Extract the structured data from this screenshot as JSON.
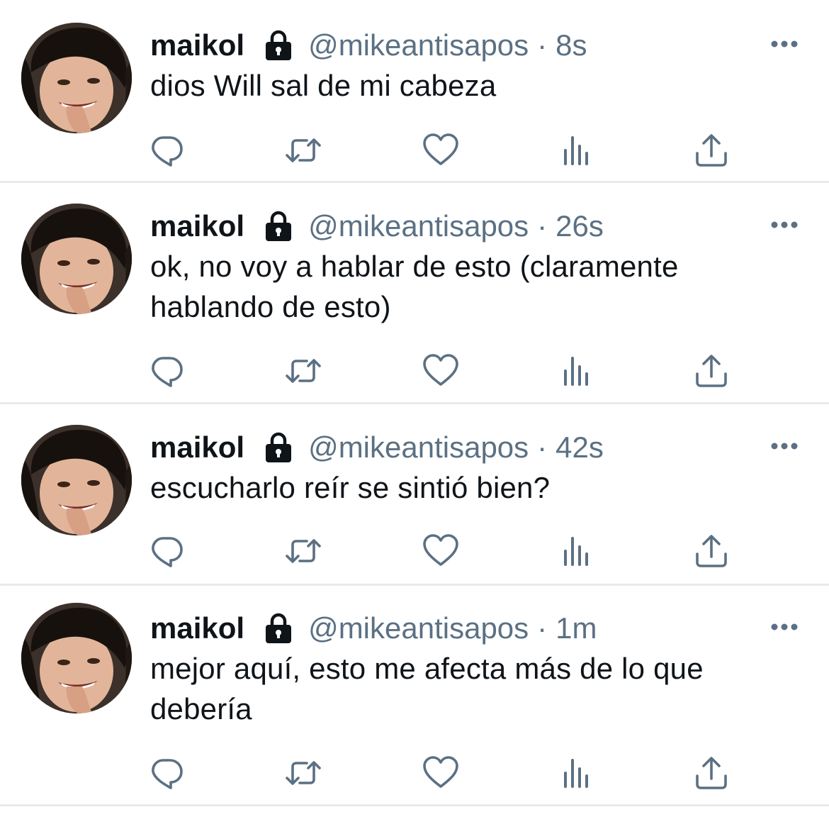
{
  "tweets": [
    {
      "name": "maikol",
      "handle": "@mikeantisapos",
      "separator": "·",
      "time": "8s",
      "text": "dios Will sal de mi cabeza"
    },
    {
      "name": "maikol",
      "handle": "@mikeantisapos",
      "separator": "·",
      "time": "26s",
      "text": "ok, no voy a hablar de esto (claramente hablando de esto)"
    },
    {
      "name": "maikol",
      "handle": "@mikeantisapos",
      "separator": "·",
      "time": "42s",
      "text": "escucharlo reír se sintió bien?"
    },
    {
      "name": "maikol",
      "handle": "@mikeantisapos",
      "separator": "·",
      "time": "1m",
      "text": "mejor aquí, esto me afecta más de lo que debería"
    }
  ],
  "icons": {
    "protected": "lock-icon",
    "more": "more-dots-icon",
    "reply": "reply-icon",
    "retweet": "retweet-icon",
    "like": "like-icon",
    "analytics": "analytics-icon",
    "share": "share-icon"
  },
  "colors": {
    "text": "#0f1419",
    "secondary": "#5b7083",
    "divider": "#e8eaed"
  }
}
